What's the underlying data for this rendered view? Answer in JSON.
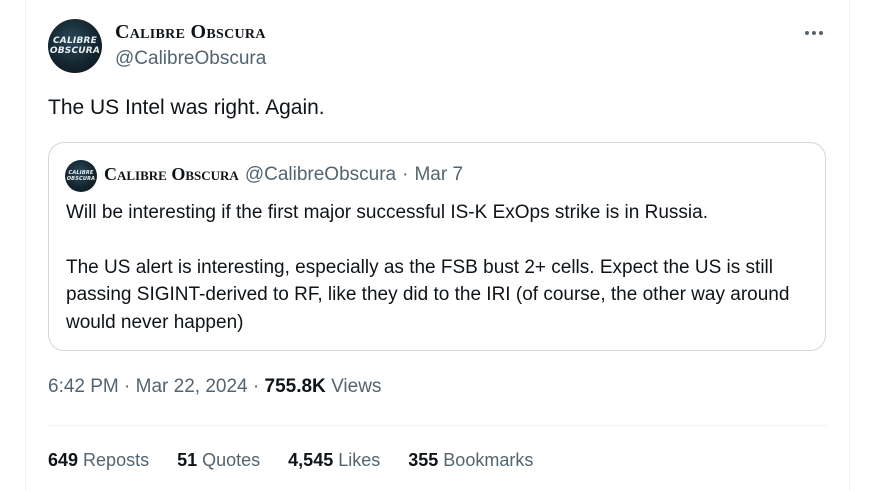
{
  "author": {
    "display_name": "Calibre Obscura",
    "handle": "@CalibreObscura",
    "avatar_text_line1": "CALIBRE",
    "avatar_text_line2": "OBSCURA"
  },
  "tweet": {
    "text": "The US Intel was right. Again.",
    "time": "6:42 PM",
    "sep1": "·",
    "date": "Mar 22, 2024",
    "sep2": "·",
    "views_count": "755.8K",
    "views_label": "Views"
  },
  "quoted": {
    "display_name": "Calibre Obscura",
    "handle": "@CalibreObscura",
    "sep": "·",
    "date": "Mar 7",
    "paragraph1": "Will be interesting if the first major successful IS-K ExOps strike is in Russia.",
    "paragraph2": "The US alert is interesting, especially as the FSB bust 2+ cells. Expect the US is still passing SIGINT-derived to RF, like they did to the IRI (of course, the other way around would never happen)"
  },
  "stats": {
    "reposts_count": "649",
    "reposts_label": "Reposts",
    "quotes_count": "51",
    "quotes_label": "Quotes",
    "likes_count": "4,545",
    "likes_label": "Likes",
    "bookmarks_count": "355",
    "bookmarks_label": "Bookmarks"
  },
  "icons": {
    "more": "more-horizontal-icon"
  },
  "colors": {
    "text_primary": "#0f1419",
    "text_secondary": "#536471",
    "border": "#cfd9de",
    "divider": "#eff3f4"
  }
}
